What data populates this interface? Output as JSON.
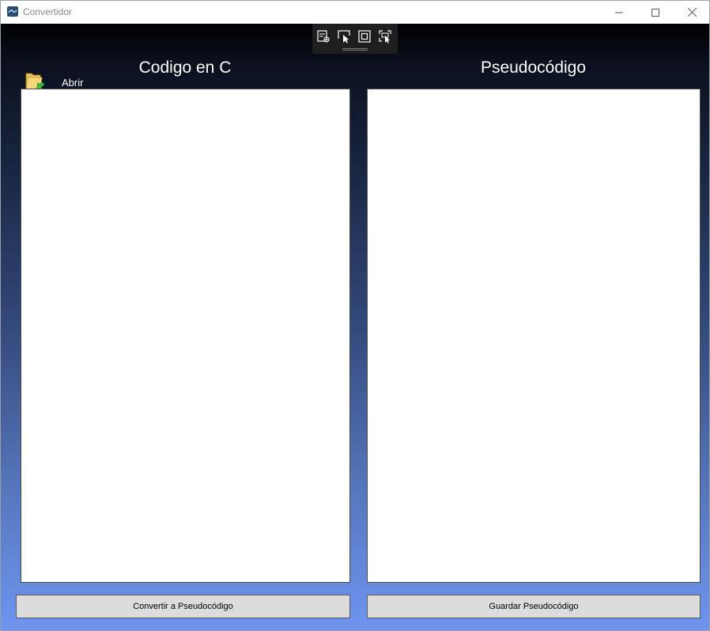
{
  "window": {
    "title": "Convertidor"
  },
  "debug_toolbar": {
    "icons": [
      "live-visual-tree-icon",
      "select-element-icon",
      "display-layout-adorners-icon",
      "track-focus-icon"
    ]
  },
  "left_panel": {
    "heading": "Codigo en C",
    "open_label": "Abrir",
    "code_value": "",
    "action_label": "Convertir a Pseudocódigo"
  },
  "right_panel": {
    "heading": "Pseudocódigo",
    "pseudo_value": "",
    "action_label": "Guardar Pseudocódigo"
  },
  "colors": {
    "gradient_top": "#000000",
    "gradient_bottom": "#6e94f0",
    "button_bg": "#dcdcdc"
  }
}
